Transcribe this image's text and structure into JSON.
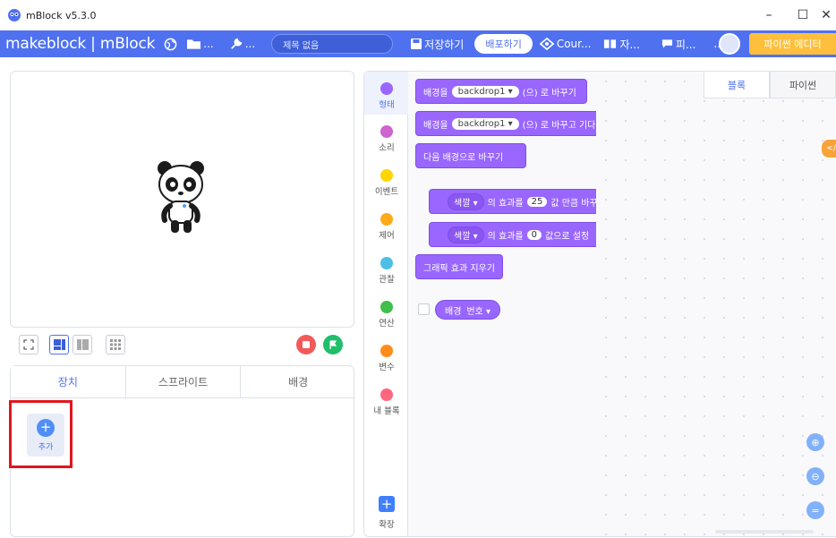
{
  "window": {
    "title": "mBlock v5.3.0"
  },
  "menubar": {
    "brand": "makeblock | mBlock",
    "file_menu": "...",
    "edit_menu": "...",
    "project_title_placeholder": "제목 없음",
    "save": "저장하기",
    "publish": "배포하기",
    "courses": "Cour...",
    "tutorials": "자...",
    "feedback": "피...",
    "more": "...",
    "python_editor": "파이썬 에디터"
  },
  "device_tabs": [
    {
      "label": "장치"
    },
    {
      "label": "스프라이트"
    },
    {
      "label": "배경"
    }
  ],
  "add_device": {
    "label": "추가"
  },
  "categories": [
    {
      "label": "형태",
      "color": "#9966ff"
    },
    {
      "label": "소리",
      "color": "#cf63cf"
    },
    {
      "label": "이벤트",
      "color": "#ffd500"
    },
    {
      "label": "제어",
      "color": "#ffab19"
    },
    {
      "label": "관찰",
      "color": "#4cbfe6"
    },
    {
      "label": "연산",
      "color": "#40bf4a"
    },
    {
      "label": "변수",
      "color": "#ff8c1a"
    },
    {
      "label": "내 블록",
      "color": "#ff6680"
    }
  ],
  "extension": {
    "label": "확장"
  },
  "blocks": {
    "switch_backdrop": {
      "prefix": "배경을",
      "value": "backdrop1 ▾",
      "suffix": "(으) 로 바꾸기"
    },
    "switch_backdrop_wait": {
      "prefix": "배경을",
      "value": "backdrop1 ▾",
      "suffix": "(으) 로 바꾸고 기다"
    },
    "next_backdrop": {
      "text": "다음 배경으로 바꾸기"
    },
    "change_effect": {
      "value": "색깔 ▾",
      "mid": "의 효과를",
      "num": "25",
      "suffix": "값 만큼 바꾸"
    },
    "set_effect": {
      "value": "색깔 ▾",
      "mid": "의 효과를",
      "num": "0",
      "suffix": "값으로 설정"
    },
    "clear_effects": {
      "text": "그래픽 효과 지우기"
    },
    "backdrop_reporter": {
      "label": "배경",
      "value": "번호 ▾"
    }
  },
  "workspace_tabs": [
    {
      "label": "블록"
    },
    {
      "label": "파이썬"
    }
  ],
  "colors": {
    "accent": "#4f71f0",
    "looks": "#9966ff",
    "highlight": "#e0161d",
    "python_button": "#ffbf3c"
  }
}
